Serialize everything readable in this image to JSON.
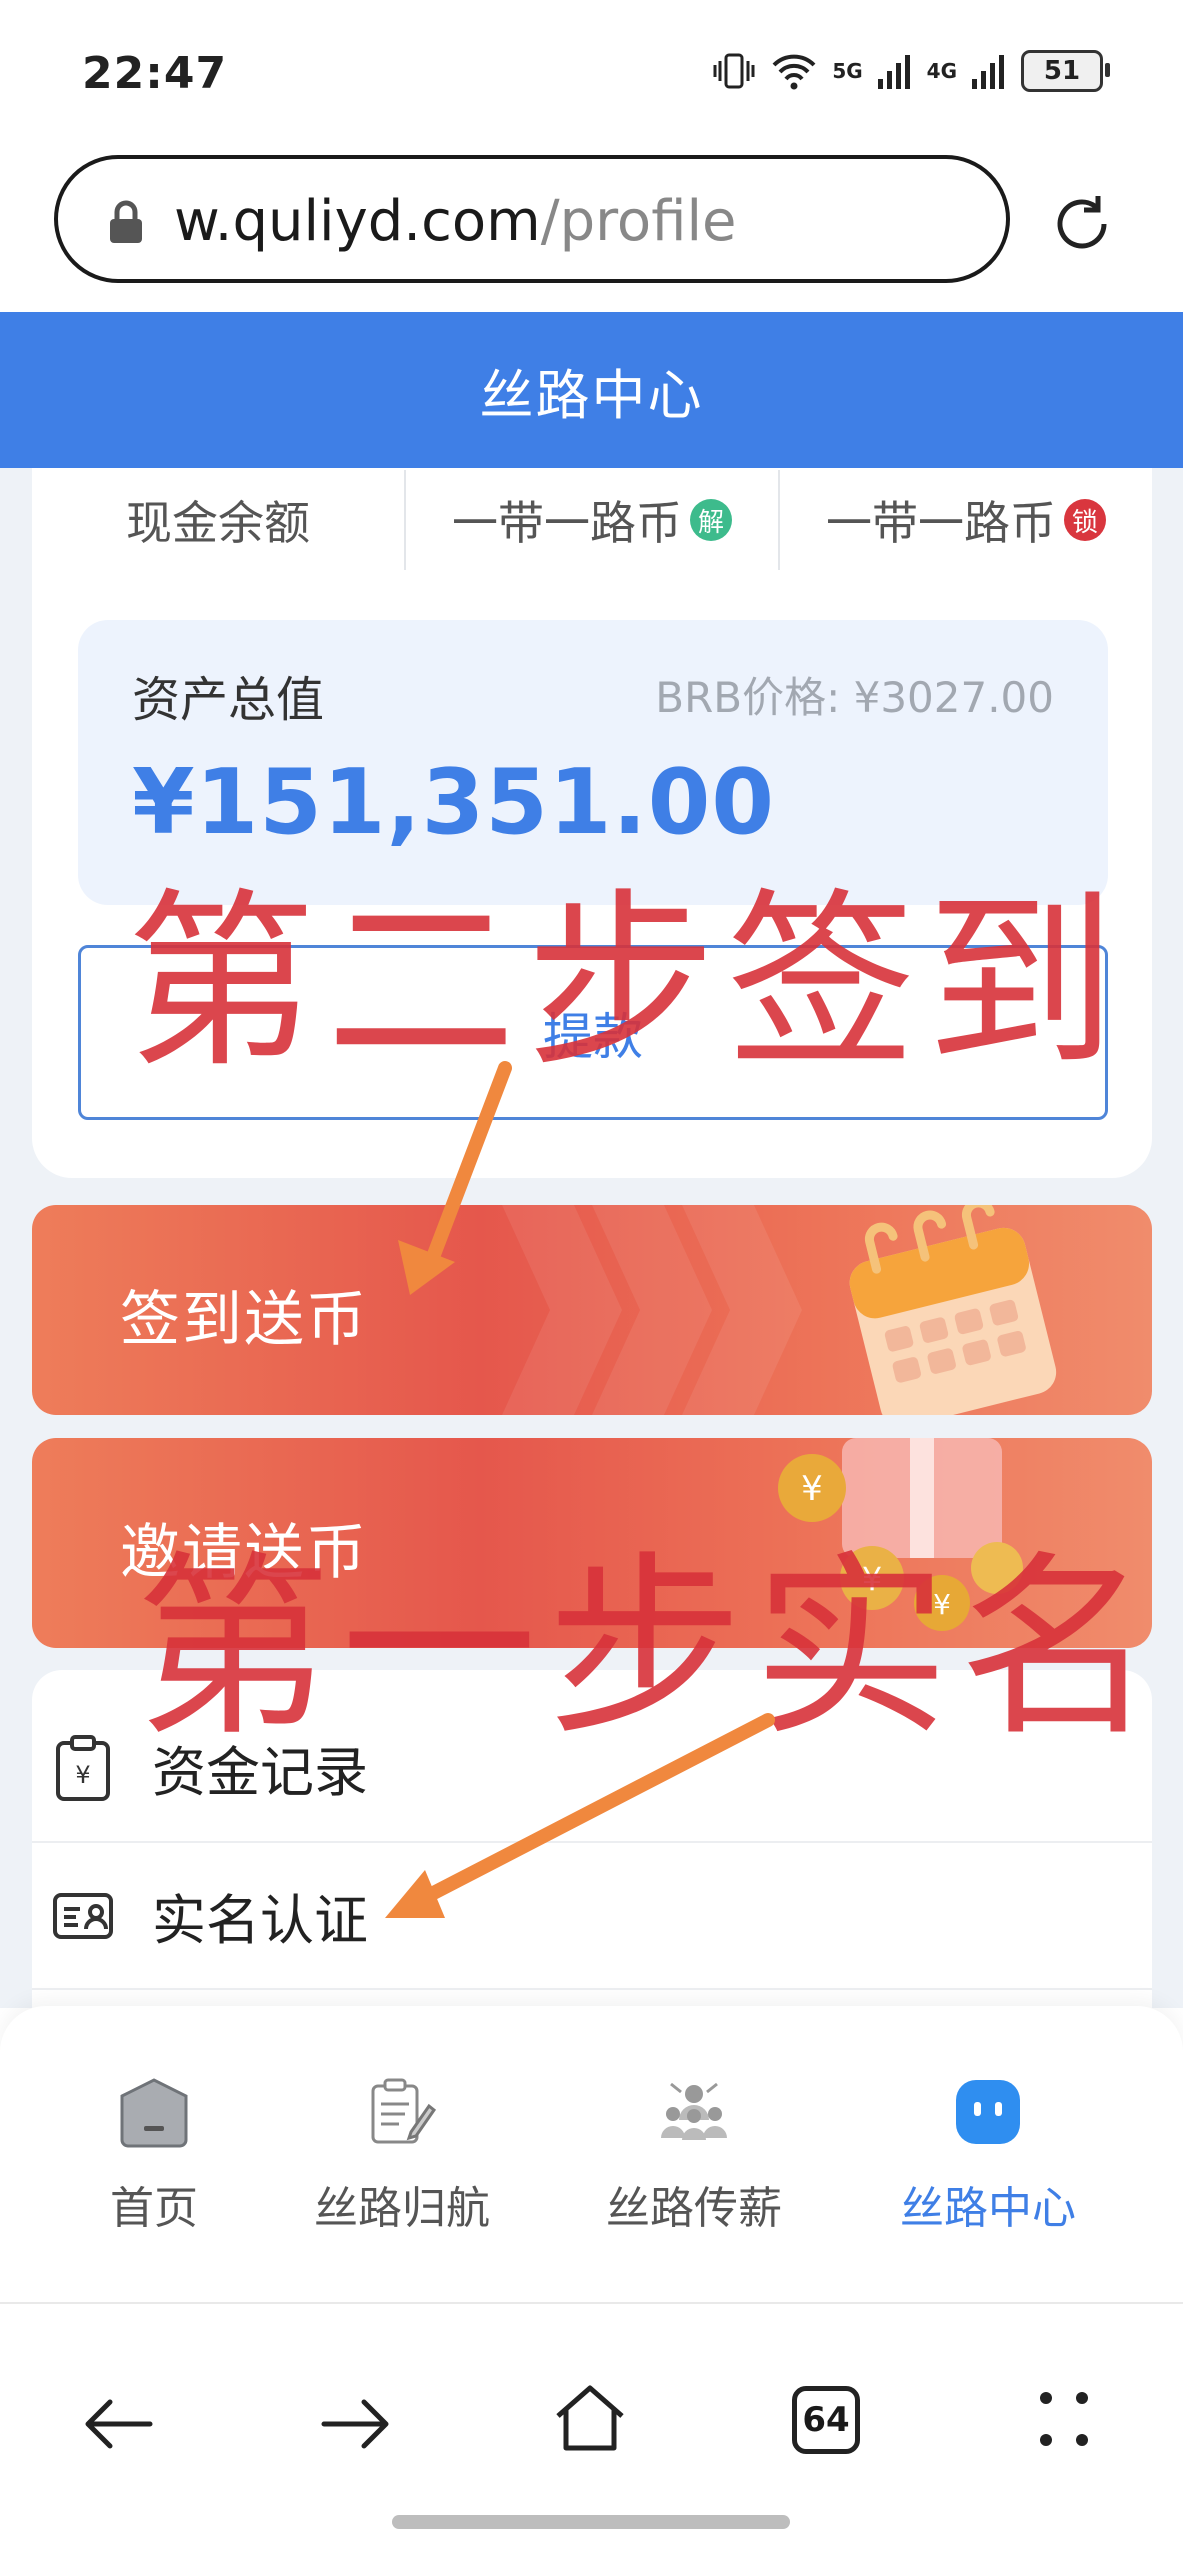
{
  "status_bar": {
    "time": "22:47",
    "net1": "5G",
    "net2": "4G",
    "battery": "51"
  },
  "browser": {
    "url_host": "w.quliyd.com",
    "url_path": "/profile",
    "tab_count": "64"
  },
  "header": {
    "title": "丝路中心"
  },
  "tabs": [
    {
      "label": "现金余额",
      "badge": ""
    },
    {
      "label": "一带一路币",
      "badge": "解"
    },
    {
      "label": "一带一路币",
      "badge": "锁"
    }
  ],
  "assets": {
    "label": "资产总值",
    "brb_price": "BRB价格: ¥3027.00",
    "value": "¥151,351.00"
  },
  "withdraw": {
    "label": "提款"
  },
  "promos": {
    "checkin": "签到送币",
    "invite": "邀请送币"
  },
  "menu": [
    {
      "label": "资金记录",
      "icon": "yuan-clipboard-icon"
    },
    {
      "label": "实名认证",
      "icon": "id-card-icon"
    }
  ],
  "bottom_nav": [
    {
      "label": "首页",
      "icon": "home-icon",
      "active": false
    },
    {
      "label": "丝路归航",
      "icon": "clipboard-pen-icon",
      "active": false
    },
    {
      "label": "丝路传薪",
      "icon": "team-icon",
      "active": false
    },
    {
      "label": "丝路中心",
      "icon": "robot-face-icon",
      "active": true
    }
  ],
  "annotations": {
    "step2": "第二步签到",
    "step1": "第一步实名"
  },
  "colors": {
    "primary": "#3f7fe6",
    "promo": "#e5574c",
    "annotation": "#d8323a",
    "arrow": "#f0883e"
  }
}
